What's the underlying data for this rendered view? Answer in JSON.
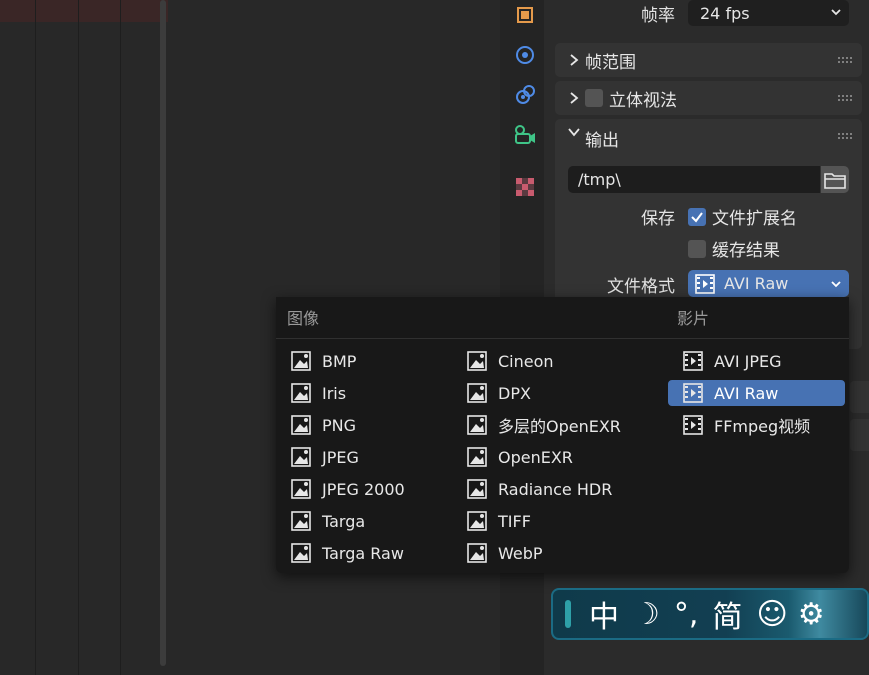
{
  "properties": {
    "frame_rate_label": "帧率",
    "frame_rate_value": "24 fps",
    "sections": {
      "frame_range": "帧范围",
      "stereoscopy": "立体视法",
      "output": "输出"
    },
    "output": {
      "path": "/tmp\\",
      "save_label": "保存",
      "file_extensions_label": "文件扩展名",
      "file_extensions_checked": true,
      "cache_result_label": "缓存结果",
      "cache_result_checked": false,
      "file_format_label": "文件格式",
      "file_format_value": "AVI Raw"
    }
  },
  "tools": [
    "object-properties-icon",
    "physics-icon",
    "constraints-icon",
    "camera-data-icon",
    "texture-icon"
  ],
  "menu": {
    "image_header": "图像",
    "movie_header": "影片",
    "image_col1": [
      "BMP",
      "Iris",
      "PNG",
      "JPEG",
      "JPEG 2000",
      "Targa",
      "Targa Raw"
    ],
    "image_col2": [
      "Cineon",
      "DPX",
      "多层的OpenEXR",
      "OpenEXR",
      "Radiance HDR",
      "TIFF",
      "WebP"
    ],
    "movie_col": [
      "AVI JPEG",
      "AVI Raw",
      "FFmpeg视频"
    ],
    "selected": "AVI Raw"
  },
  "ime": {
    "lang": "中",
    "moon": "☽",
    "punct": "°,",
    "simplified": "简",
    "emoji": "☺",
    "settings": "⚙"
  },
  "colors": {
    "accent": "#4772b3",
    "panel": "#2b2b2b",
    "menu": "#181818"
  }
}
